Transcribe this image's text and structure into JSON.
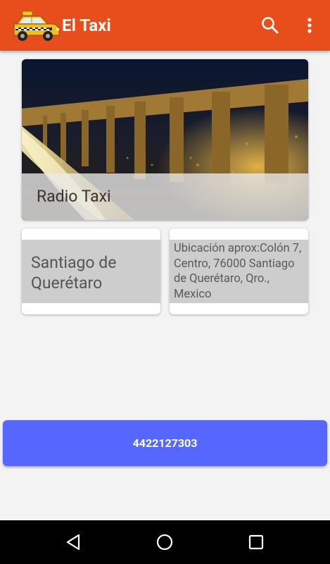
{
  "app": {
    "title": "El Taxi",
    "brand_color": "#e84e1c"
  },
  "toolbar": {
    "search_icon": "search-icon",
    "more_icon": "more-vert-icon"
  },
  "hero": {
    "title": "Radio Taxi",
    "image": "night aqueduct photo"
  },
  "info": {
    "city": "Santiago de Querétaro",
    "address": "Ubicación aprox:Colón 7, Centro, 76000 Santiago de Querétaro, Qro., Mexico"
  },
  "call": {
    "phone": "4422127303",
    "color": "#5567ff"
  },
  "navigation": {
    "back_icon": "back-icon",
    "home_icon": "home-icon",
    "recents_icon": "recents-icon"
  }
}
